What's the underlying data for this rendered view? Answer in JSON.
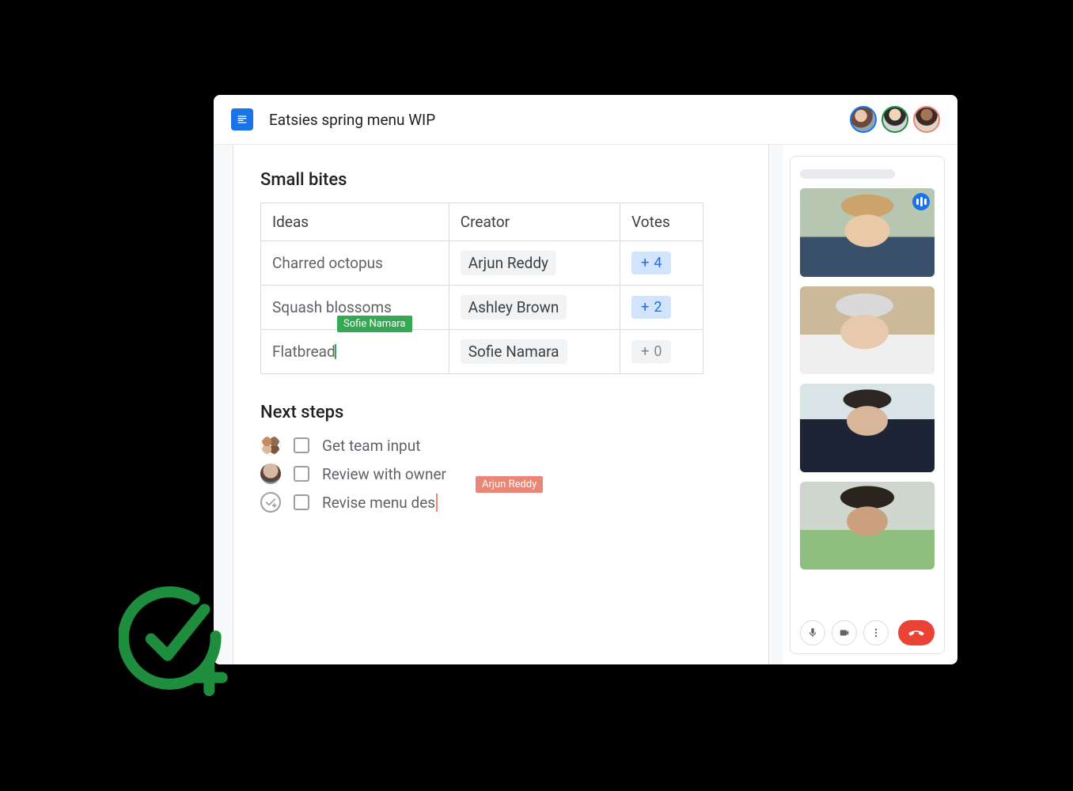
{
  "header": {
    "doc_title": "Eatsies spring menu WIP"
  },
  "section1_title": "Small bites",
  "table": {
    "headers": {
      "ideas": "Ideas",
      "creator": "Creator",
      "votes": "Votes"
    },
    "rows": [
      {
        "idea": "Charred octopus",
        "creator": "Arjun Reddy",
        "votes": "4",
        "active": true
      },
      {
        "idea": "Squash blossoms",
        "creator": "Ashley Brown",
        "votes": "2",
        "active": true
      },
      {
        "idea": "Flatbread",
        "creator": "Sofie Namara",
        "votes": "0",
        "active": false
      }
    ]
  },
  "cursor_tags": {
    "sofie": "Sofie Namara",
    "arjun": "Arjun Reddy"
  },
  "section2_title": "Next steps",
  "tasks": [
    {
      "label": "Get team input"
    },
    {
      "label": "Review with owner"
    },
    {
      "label": "Revise menu des"
    }
  ],
  "header_avatars": {
    "colors": {
      "a1": "#1a73e8",
      "a2": "#1e8e3e",
      "a3": "#ea8676"
    }
  }
}
